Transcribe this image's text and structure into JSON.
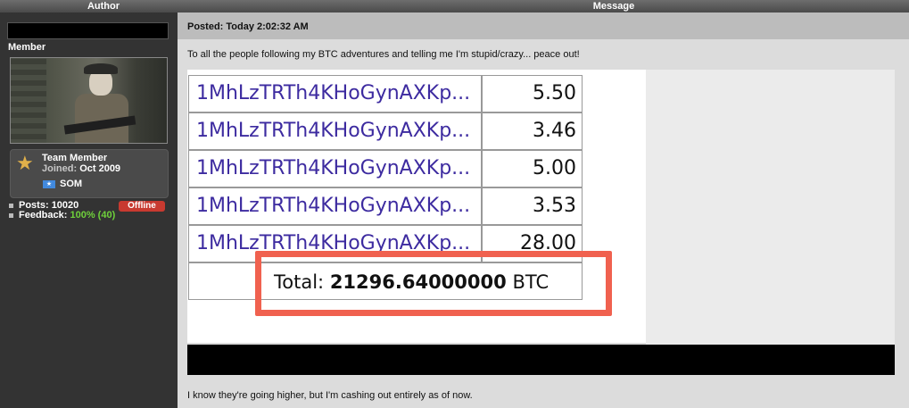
{
  "header": {
    "author": "Author",
    "message": "Message"
  },
  "sidebar": {
    "rank": "Member",
    "member_title": "Team Member",
    "joined_label": "Joined:",
    "joined_value": "Oct 2009",
    "country": "SOM",
    "posts_label": "Posts:",
    "posts_value": "10020",
    "feedback_label": "Feedback:",
    "feedback_value": "100% (40)",
    "status": "Offline",
    "colors": {
      "status_badge": "#c83a30",
      "feedback_green": "#6fd13b"
    }
  },
  "post": {
    "posted": "Posted: Today 2:02:32 AM",
    "text_top": "To all the people following my BTC adventures and telling me I'm stupid/crazy... peace out!",
    "text_bottom": "I know they're going higher, but I'm cashing out entirely as of now."
  },
  "screenshot": {
    "rows": [
      {
        "address": "1MhLzTRTh4KHoGynAXKp...",
        "amount": "5.50"
      },
      {
        "address": "1MhLzTRTh4KHoGynAXKp...",
        "amount": "3.46"
      },
      {
        "address": "1MhLzTRTh4KHoGynAXKp...",
        "amount": "5.00"
      },
      {
        "address": "1MhLzTRTh4KHoGynAXKp...",
        "amount": "3.53"
      },
      {
        "address": "1MhLzTRTh4KHoGynAXKp...",
        "amount": "28.00"
      }
    ],
    "total_label": "Total:",
    "total_value": "21296.64000000",
    "total_unit": "BTC",
    "colors": {
      "highlight": "#f0614f",
      "address_text": "#3d2ba0"
    }
  }
}
